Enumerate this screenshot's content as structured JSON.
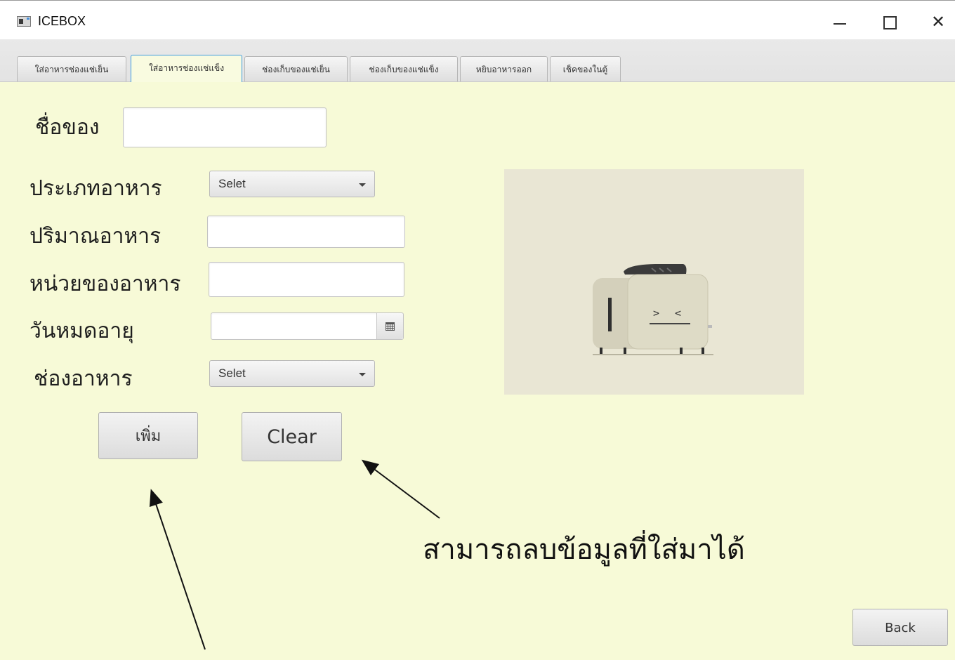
{
  "window": {
    "title": "ICEBOX",
    "close_glyph": "✕"
  },
  "tabs": [
    {
      "label": "ใส่อาหารช่องแช่เย็น",
      "selected": false
    },
    {
      "label": "ใส่อาหารช่องแช่แข็ง",
      "selected": true
    },
    {
      "label": "ช่องเก็บของแช่เย็น",
      "selected": false
    },
    {
      "label": "ช่องเก็บของแช่แข็ง",
      "selected": false
    },
    {
      "label": "หยิบอาหารออก",
      "selected": false
    },
    {
      "label": "เช็คของในตู้",
      "selected": false
    }
  ],
  "form": {
    "name_label": "ชื่อของ",
    "name_value": "",
    "type_label": "ประเภทอาหาร",
    "type_value": "Selet",
    "quantity_label": "ปริมาณอาหาร",
    "quantity_value": "",
    "unit_label": "หน่วยของอาหาร",
    "unit_value": "",
    "expiry_label": "วันหมดอายุ",
    "expiry_value": "",
    "slot_label": "ช่องอาหาร",
    "slot_value": "Selet"
  },
  "buttons": {
    "add_label": "เพิ่ม",
    "clear_label": "Clear",
    "back_label": "Back"
  },
  "annotation": {
    "text": "สามารถลบข้อมูลที่ใส่มาได้"
  },
  "colors": {
    "content_background": "#f7fad7",
    "selected_tab_border": "#3d9be0"
  },
  "icons": {
    "app": "app-window-icon",
    "calendar": "calendar-icon",
    "dropdown": "chevron-down-icon"
  }
}
